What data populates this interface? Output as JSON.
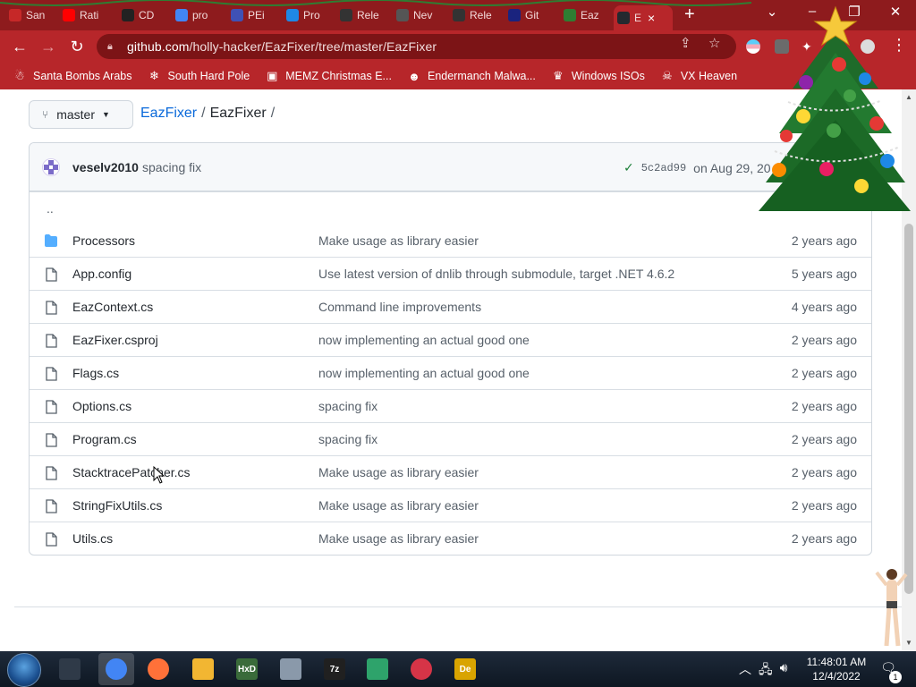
{
  "browser": {
    "tabs": [
      {
        "label": "San",
        "color": "#c62828"
      },
      {
        "label": "Rati",
        "color": "#ff0000"
      },
      {
        "label": "CD",
        "color": "#222222"
      },
      {
        "label": "pro",
        "color": "#4285f4"
      },
      {
        "label": "PEi",
        "color": "#3f51b5"
      },
      {
        "label": "Pro",
        "color": "#1e88e5"
      },
      {
        "label": "Rele",
        "color": "#333333"
      },
      {
        "label": "Nev",
        "color": "#555555"
      },
      {
        "label": "Rele",
        "color": "#333333"
      },
      {
        "label": "Git",
        "color": "#1a237e"
      },
      {
        "label": "Eaz",
        "color": "#2e7d32"
      },
      {
        "label": "E",
        "color": "#24292f"
      }
    ],
    "active_tab_index": 11,
    "url_host": "github.com",
    "url_path": "/holly-hacker/EazFixer/tree/master/EazFixer"
  },
  "bookmarks": [
    {
      "label": "Santa Bombs Arabs",
      "icon": "person-icon"
    },
    {
      "label": "South Hard Pole",
      "icon": "snowflake-icon"
    },
    {
      "label": "MEMZ Christmas E...",
      "icon": "document-icon"
    },
    {
      "label": "Endermanch Malwa...",
      "icon": "mask-icon"
    },
    {
      "label": "Windows ISOs",
      "icon": "gift-icon"
    },
    {
      "label": "VX Heaven",
      "icon": "skull-icon"
    }
  ],
  "repo": {
    "branch": "master",
    "repo_name": "EazFixer",
    "current_folder": "EazFixer",
    "separator": "/"
  },
  "commit": {
    "author": "veselv2010",
    "message": "spacing fix",
    "sha": "5c2ad99",
    "date": "on Aug 29, 20"
  },
  "parent_dir": "..",
  "files": [
    {
      "name": "Processors",
      "type": "folder",
      "message": "Make usage as library easier",
      "age": "2 years ago"
    },
    {
      "name": "App.config",
      "type": "file",
      "message": "Use latest version of dnlib through submodule, target .NET 4.6.2",
      "age": "5 years ago"
    },
    {
      "name": "EazContext.cs",
      "type": "file",
      "message": "Command line improvements",
      "age": "4 years ago"
    },
    {
      "name": "EazFixer.csproj",
      "type": "file",
      "message": "now implementing an actual good one",
      "age": "2 years ago"
    },
    {
      "name": "Flags.cs",
      "type": "file",
      "message": "now implementing an actual good one",
      "age": "2 years ago"
    },
    {
      "name": "Options.cs",
      "type": "file",
      "message": "spacing fix",
      "age": "2 years ago"
    },
    {
      "name": "Program.cs",
      "type": "file",
      "message": "spacing fix",
      "age": "2 years ago"
    },
    {
      "name": "StacktracePatcher.cs",
      "type": "file",
      "message": "Make usage as library easier",
      "age": "2 years ago"
    },
    {
      "name": "StringFixUtils.cs",
      "type": "file",
      "message": "Make usage as library easier",
      "age": "2 years ago"
    },
    {
      "name": "Utils.cs",
      "type": "file",
      "message": "Make usage as library easier",
      "age": "2 years ago"
    }
  ],
  "taskbar": {
    "apps": [
      {
        "name": "explorer-view-app",
        "label": ""
      },
      {
        "name": "chrome-app",
        "label": ""
      },
      {
        "name": "firefox-app",
        "label": ""
      },
      {
        "name": "file-explorer-app",
        "label": ""
      },
      {
        "name": "hex-editor-app",
        "label": "HxD"
      },
      {
        "name": "system-app",
        "label": ""
      },
      {
        "name": "7zip-app",
        "label": "7z"
      },
      {
        "name": "green-app",
        "label": ""
      },
      {
        "name": "red-app",
        "label": ""
      },
      {
        "name": "de-app",
        "label": "De"
      }
    ],
    "time": "11:48:01 AM",
    "date": "12/4/2022",
    "notification_count": "1"
  },
  "colors": {
    "tabstrip": "#8e1b1d",
    "toolbar": "#b7262a",
    "link": "#0969da",
    "success": "#1a7f37"
  }
}
